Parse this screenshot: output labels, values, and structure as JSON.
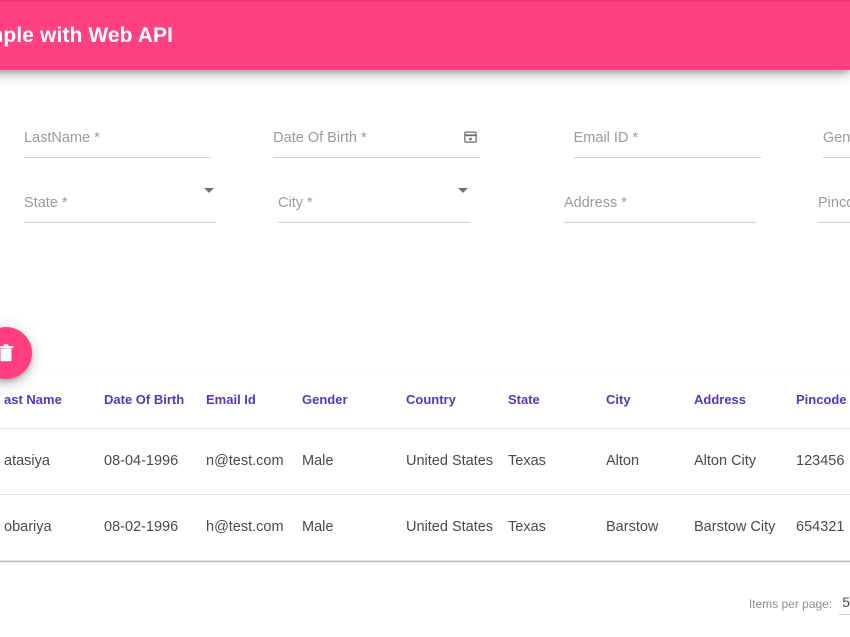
{
  "toolbar": {
    "title": "CRUD Example with Web API",
    "background_color": "#ff4081",
    "text_color": "#ffffff"
  },
  "form": {
    "rows": [
      {
        "fields": [
          {
            "label": "LastName *",
            "value": "",
            "type": "text",
            "name": "lastname-field"
          },
          {
            "label": "Date Of Birth *",
            "value": "",
            "type": "date",
            "name": "date-of-birth-field",
            "suffix_icon": "calendar-icon"
          },
          {
            "label": "Email ID *",
            "value": "",
            "type": "email",
            "name": "email-id-field"
          },
          {
            "label": "Gender *",
            "value": "",
            "type": "select",
            "name": "gender-field",
            "clipped": true
          }
        ]
      },
      {
        "fields": [
          {
            "label": "State *",
            "value": "",
            "type": "select",
            "name": "state-field",
            "suffix_icon": "chevron-down-icon"
          },
          {
            "label": "City *",
            "value": "",
            "type": "select",
            "name": "city-field",
            "suffix_icon": "chevron-down-icon"
          },
          {
            "label": "Address *",
            "value": "",
            "type": "text",
            "name": "address-field"
          },
          {
            "label": "Pincode *",
            "value": "",
            "type": "text",
            "name": "pincode-field",
            "clipped": true
          }
        ]
      }
    ]
  },
  "fab": {
    "icon": "delete-icon",
    "color": "#ff3d80",
    "label": ""
  },
  "table": {
    "columns": [
      {
        "key": "first_name",
        "label": ""
      },
      {
        "key": "last_name",
        "label": "ast Name"
      },
      {
        "key": "dob",
        "label": "Date Of Birth"
      },
      {
        "key": "email",
        "label": "Email Id"
      },
      {
        "key": "gender",
        "label": "Gender"
      },
      {
        "key": "country",
        "label": "Country"
      },
      {
        "key": "state",
        "label": "State"
      },
      {
        "key": "city",
        "label": "City"
      },
      {
        "key": "address",
        "label": "Address"
      },
      {
        "key": "pincode",
        "label": "Pincode"
      }
    ],
    "rows": [
      {
        "first_name": "",
        "last_name": "atasiya",
        "dob": "08-04-1996",
        "email": "n@test.com",
        "gender": "Male",
        "country": "United States",
        "state": "Texas",
        "city": "Alton",
        "address": "Alton City",
        "pincode": "123456"
      },
      {
        "first_name": "",
        "last_name": "obariya",
        "dob": "08-02-1996",
        "email": "h@test.com",
        "gender": "Male",
        "country": "United States",
        "state": "Texas",
        "city": "Barstow",
        "address": "Barstow City",
        "pincode": "654321"
      }
    ],
    "header_color": "#5b34c0"
  },
  "paginator": {
    "items_per_page_label": "Items per page:",
    "items_per_page_value": "5"
  }
}
